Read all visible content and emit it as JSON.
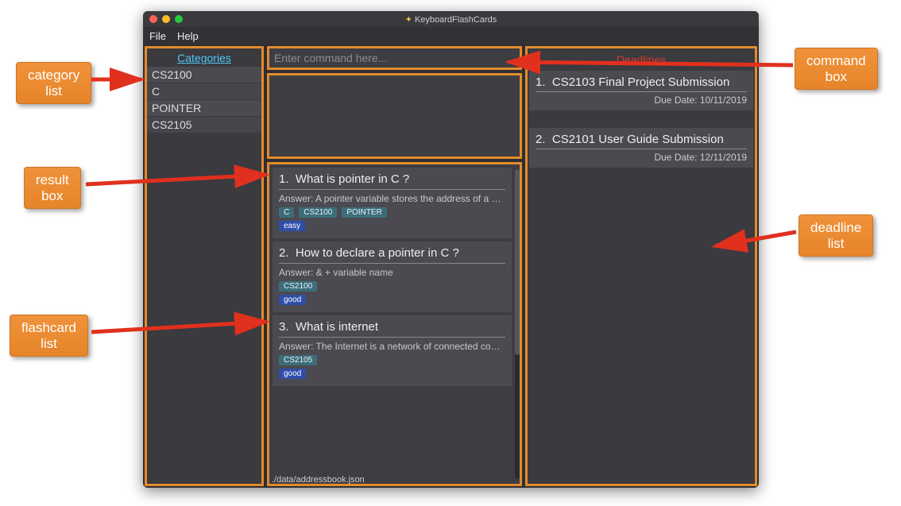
{
  "window": {
    "title": "KeyboardFlashCards"
  },
  "menu": {
    "file": "File",
    "help": "Help"
  },
  "sidebar": {
    "title": "Categories",
    "items": [
      "CS2100",
      "C",
      "POINTER",
      "CS2105"
    ]
  },
  "command": {
    "placeholder": "Enter command here..."
  },
  "flashcards": [
    {
      "num": "1.",
      "q": "What is pointer in C ?",
      "ans": "Answer: A pointer variable stores the address of a memory locat...",
      "tags": [
        "C",
        "CS2100",
        "POINTER"
      ],
      "badge": "easy"
    },
    {
      "num": "2.",
      "q": "How to declare a pointer in C ?",
      "ans": "Answer: & + variable name",
      "tags": [
        "CS2100"
      ],
      "badge": "good"
    },
    {
      "num": "3.",
      "q": "What is internet",
      "ans": "Answer: The Internet is a network of connected computing devi...",
      "tags": [
        "CS2105"
      ],
      "badge": "good"
    }
  ],
  "deadlines": {
    "title": "Deadlines",
    "items": [
      {
        "num": "1.",
        "title": "CS2103 Final Project Submission",
        "due": "Due Date: 10/11/2019"
      },
      {
        "num": "2.",
        "title": "CS2101 User Guide Submission",
        "due": "Due Date: 12/11/2019"
      }
    ]
  },
  "status": {
    "path": "./data/addressbook.json"
  },
  "callouts": {
    "category_list": "category\nlist",
    "result_box": "result\nbox",
    "flashcard_list": "flashcard\nlist",
    "command_box": "command\nbox",
    "deadline_list": "deadline\nlist"
  }
}
